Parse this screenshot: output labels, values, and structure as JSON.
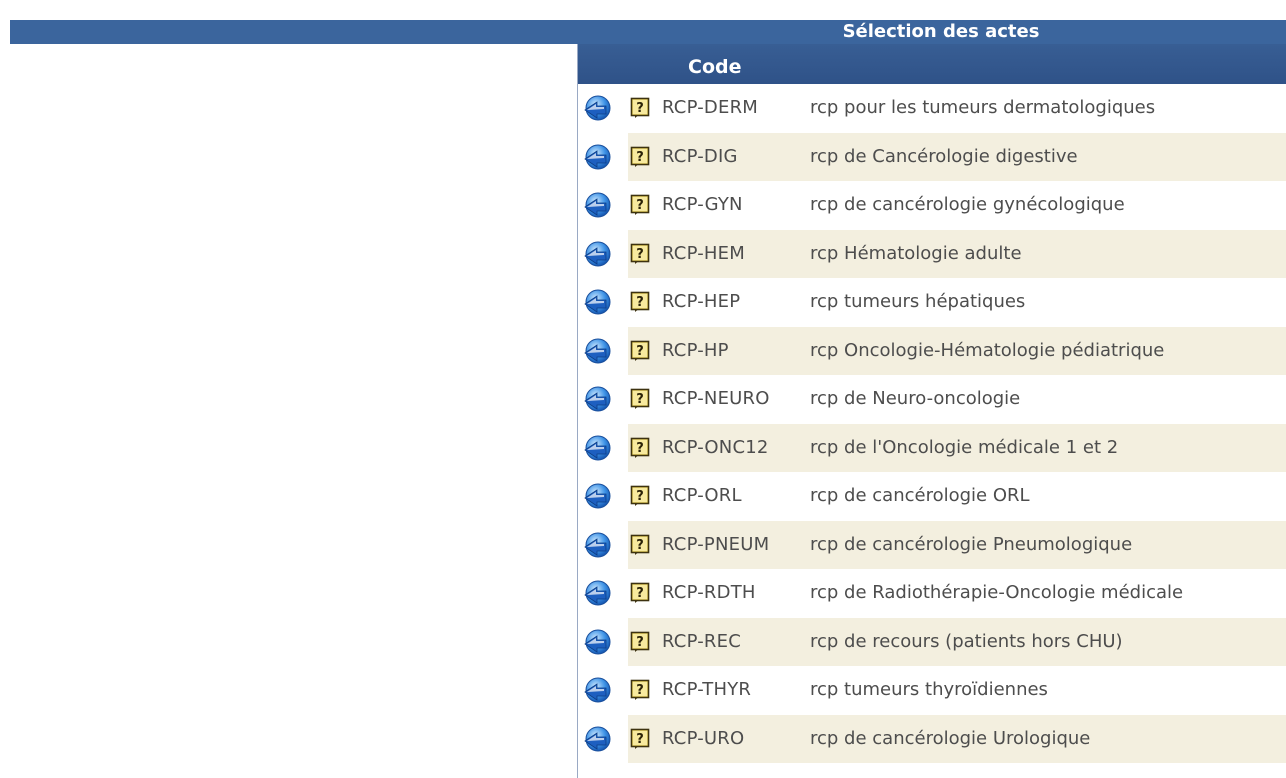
{
  "title": "Sélection des actes",
  "column_header": "Code",
  "rows": [
    {
      "code": "RCP-DERM",
      "label": "rcp pour les tumeurs dermatologiques"
    },
    {
      "code": "RCP-DIG",
      "label": "rcp de Cancérologie digestive"
    },
    {
      "code": "RCP-GYN",
      "label": "rcp de cancérologie gynécologique"
    },
    {
      "code": "RCP-HEM",
      "label": "rcp Hématologie adulte"
    },
    {
      "code": "RCP-HEP",
      "label": "rcp tumeurs hépatiques"
    },
    {
      "code": "RCP-HP",
      "label": "rcp Oncologie-Hématologie pédiatrique"
    },
    {
      "code": "RCP-NEURO",
      "label": "rcp de Neuro-oncologie"
    },
    {
      "code": "RCP-ONC12",
      "label": "rcp de l'Oncologie médicale 1 et 2"
    },
    {
      "code": "RCP-ORL",
      "label": "rcp de cancérologie ORL"
    },
    {
      "code": "RCP-PNEUM",
      "label": "rcp de cancérologie Pneumologique"
    },
    {
      "code": "RCP-RDTH",
      "label": "rcp de Radiothérapie-Oncologie médicale"
    },
    {
      "code": "RCP-REC",
      "label": "rcp de recours (patients hors CHU)"
    },
    {
      "code": "RCP-THYR",
      "label": "rcp tumeurs thyroïdiennes"
    },
    {
      "code": "RCP-URO",
      "label": "rcp de cancérologie Urologique"
    }
  ],
  "icons": {
    "select": "select-arrow-icon",
    "help": "help-question-icon"
  },
  "colors": {
    "header_blue": "#3b659d",
    "row_stripe": "#f3efdf",
    "text": "#4d4d4d"
  }
}
